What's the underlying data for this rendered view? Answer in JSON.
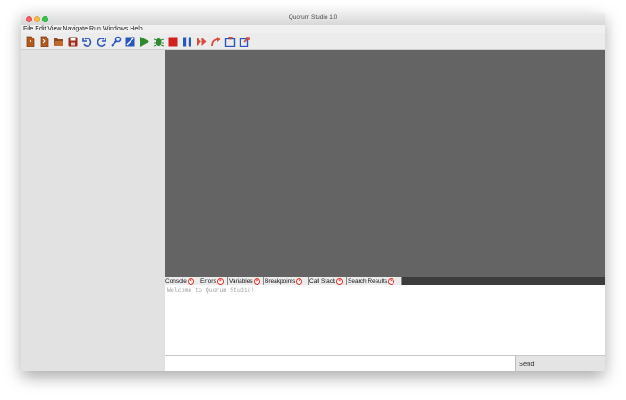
{
  "window": {
    "title": "Quorum Studio 1.0"
  },
  "menu": [
    "File",
    "Edit",
    "View",
    "Navigate",
    "Run",
    "Windows",
    "Help"
  ],
  "toolbar": [
    {
      "name": "new-file-icon"
    },
    {
      "name": "new-project-icon"
    },
    {
      "name": "open-folder-icon"
    },
    {
      "name": "save-icon"
    },
    {
      "name": "undo-icon"
    },
    {
      "name": "redo-icon"
    },
    {
      "name": "build-wrench-icon"
    },
    {
      "name": "clean-build-icon"
    },
    {
      "name": "run-play-icon"
    },
    {
      "name": "debug-bug-icon"
    },
    {
      "name": "stop-icon"
    },
    {
      "name": "pause-icon"
    },
    {
      "name": "continue-icon"
    },
    {
      "name": "step-over-icon"
    },
    {
      "name": "step-into-icon"
    },
    {
      "name": "step-out-icon"
    }
  ],
  "tabs": [
    {
      "label": "Console"
    },
    {
      "label": "Errors"
    },
    {
      "label": "Variables"
    },
    {
      "label": "Breakpoints"
    },
    {
      "label": "Call Stack"
    },
    {
      "label": "Search Results"
    }
  ],
  "console": {
    "text": "Welcome to Quorum Studio!"
  },
  "input": {
    "value": "",
    "send_label": "Send"
  },
  "colors": {
    "close": "#fc605b",
    "minimize": "#fdbc40",
    "maximize": "#34c84a",
    "tab_close": "#e0342b",
    "editor_bg": "#646464"
  }
}
